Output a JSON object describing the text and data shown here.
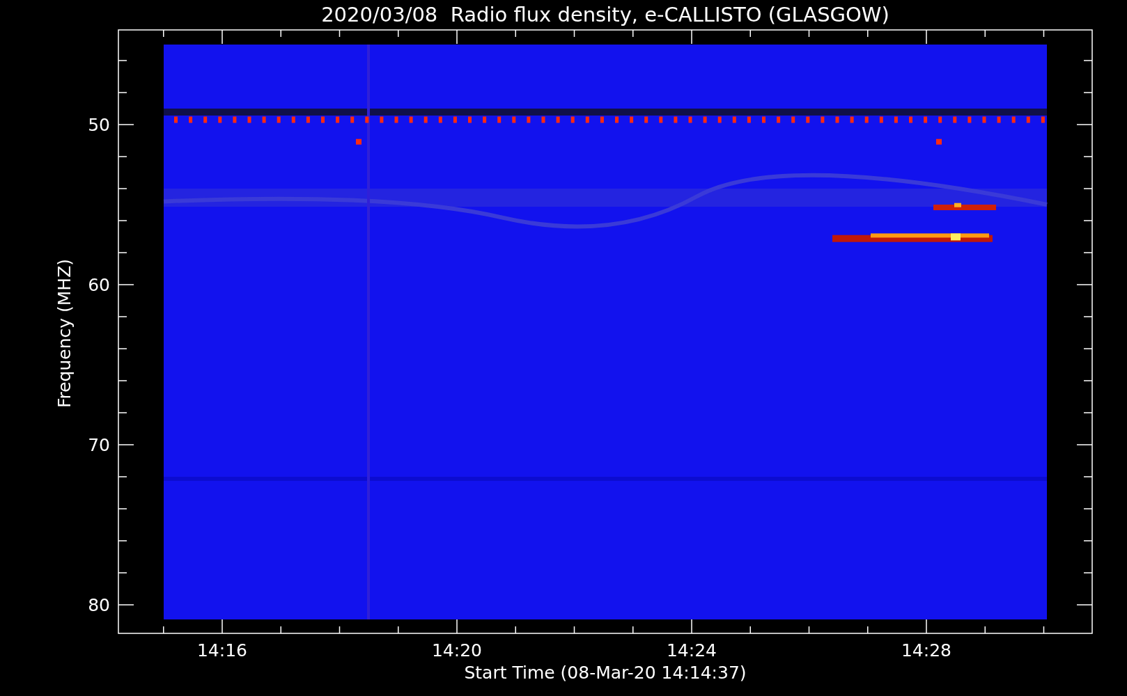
{
  "title": "2020/03/08  Radio flux density, e-CALLISTO (GLASGOW)",
  "plot": {
    "xlabel": "Start Time (08-Mar-20 14:14:37)",
    "ylabel": "Frequency (MHZ)",
    "xticks": [
      "14:16",
      "14:20",
      "14:24",
      "14:28"
    ],
    "yticks": [
      "50",
      "60",
      "70",
      "80"
    ]
  }
}
